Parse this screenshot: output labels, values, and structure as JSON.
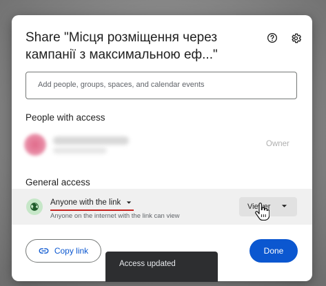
{
  "dialog": {
    "title_line1": "Share \"Місця розміщення через",
    "title_line2": "кампанії з максимальною еф...\"",
    "help_icon": "help-circle-icon",
    "settings_icon": "gear-icon"
  },
  "add_people": {
    "placeholder": "Add people, groups, spaces, and calendar events"
  },
  "people_with_access": {
    "label": "People with access",
    "people": [
      {
        "role": "Owner"
      }
    ]
  },
  "general_access": {
    "label": "General access",
    "link_setting": "Anyone with the link",
    "link_description": "Anyone on the internet with the link can view",
    "role": "Viewer",
    "icon": "globe-icon"
  },
  "actions": {
    "copy_link": "Copy link",
    "done": "Done"
  },
  "snackbar": {
    "message": "Access updated"
  },
  "colors": {
    "accent": "#0b57d0",
    "globe_bg": "#c6e7c8",
    "underline": "#c5221f",
    "snackbar_bg": "#2d2e30"
  }
}
